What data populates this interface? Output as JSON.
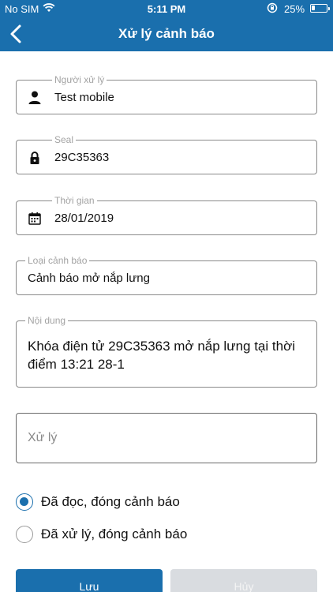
{
  "status_bar": {
    "carrier": "No SIM",
    "time": "5:11 PM",
    "battery_percent": "25%",
    "battery_level": 0.25
  },
  "header": {
    "title": "Xử lý cảnh báo"
  },
  "form": {
    "handler": {
      "label": "Người xử lý",
      "value": "Test mobile",
      "icon": "person-icon"
    },
    "seal": {
      "label": "Seal",
      "value": "29C35363",
      "icon": "lock-icon"
    },
    "time": {
      "label": "Thời gian",
      "value": "28/01/2019",
      "icon": "calendar-icon"
    },
    "alert_type": {
      "label": "Loại cảnh báo",
      "value": "Cảnh báo mở nắp lưng"
    },
    "content": {
      "label": "Nội dung",
      "value": "Khóa điện tử 29C35363 mở nắp lưng tại thời điểm 13:21 28-1"
    },
    "process": {
      "placeholder": "Xử lý"
    }
  },
  "options": [
    {
      "label": "Đã đọc, đóng cảnh báo",
      "checked": true
    },
    {
      "label": "Đã xử lý, đóng cảnh báo",
      "checked": false
    }
  ],
  "buttons": {
    "save": "Lưu",
    "cancel": "Hủy"
  },
  "colors": {
    "primary": "#1a6fad",
    "disabled": "#d9dce0"
  }
}
